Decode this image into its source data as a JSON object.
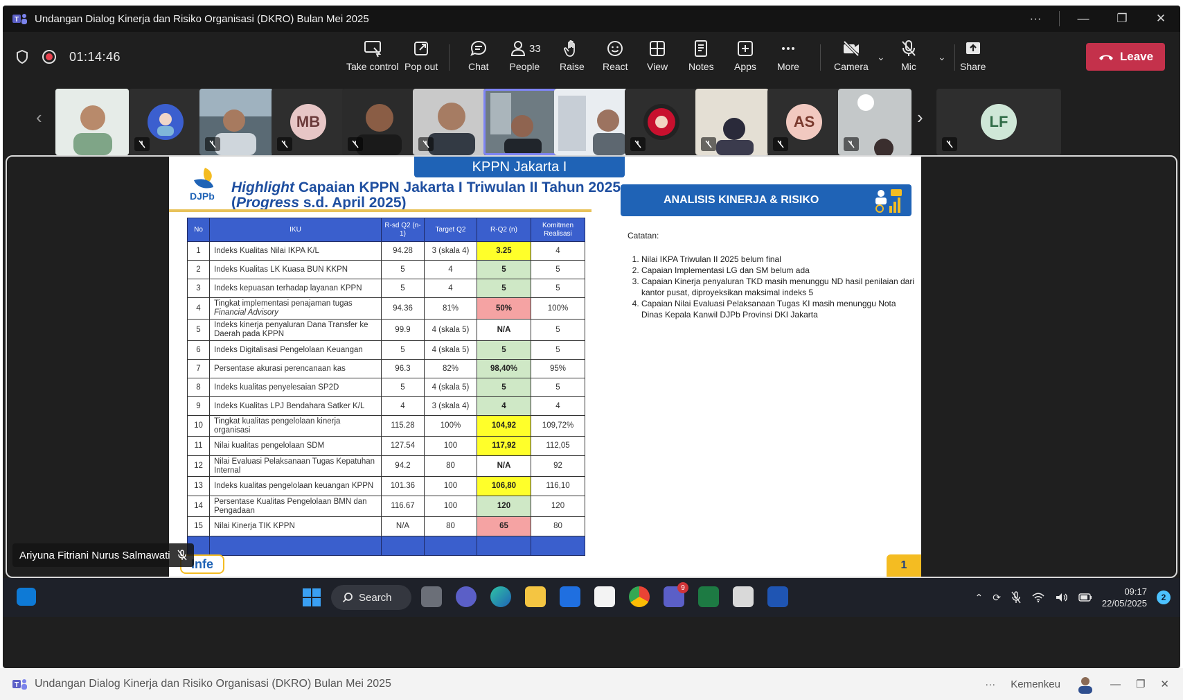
{
  "window": {
    "title": "Undangan Dialog Kinerja dan Risiko Organisasi (DKRO) Bulan Mei 2025",
    "more_label": "···",
    "minimize_label": "—",
    "restore_label": "❐",
    "close_label": "✕"
  },
  "toolbar": {
    "timer": "01:14:46",
    "take_control": "Take control",
    "pop_out": "Pop out",
    "chat": "Chat",
    "people": "People",
    "people_count": "33",
    "raise": "Raise",
    "react": "React",
    "view": "View",
    "notes": "Notes",
    "apps": "Apps",
    "more": "More",
    "camera": "Camera",
    "mic": "Mic",
    "share": "Share",
    "leave": "Leave"
  },
  "participants": [
    {
      "initials": "",
      "kind": "video",
      "muted": false
    },
    {
      "initials": "",
      "kind": "avatar-photo",
      "muted": true
    },
    {
      "initials": "",
      "kind": "video",
      "muted": true
    },
    {
      "initials": "MB",
      "kind": "initials",
      "muted": true,
      "color": "#e7c6c6"
    },
    {
      "initials": "",
      "kind": "video",
      "muted": true
    },
    {
      "initials": "",
      "kind": "video",
      "muted": true
    },
    {
      "initials": "",
      "kind": "video",
      "muted": false,
      "selected": true
    },
    {
      "initials": "",
      "kind": "video",
      "muted": false
    },
    {
      "initials": "",
      "kind": "avatar-photo",
      "muted": true
    },
    {
      "initials": "",
      "kind": "video",
      "muted": true
    },
    {
      "initials": "AS",
      "kind": "initials",
      "muted": true,
      "color": "#f1c9c0"
    },
    {
      "initials": "",
      "kind": "video",
      "muted": true
    },
    {
      "initials": "LF",
      "kind": "initials",
      "muted": true,
      "color": "#cfe7d7"
    }
  ],
  "stage": {
    "presenter_name": "Ariyuna Fitriani Nurus Salmawati"
  },
  "slide": {
    "banner": "KPPN Jakarta I",
    "logo_text": "DJPb",
    "title_line1_italic": "Highlight",
    "title_line1_rest": " Capaian KPPN Jakarta I Triwulan II Tahun 2025",
    "title_line2_open": "(",
    "title_line2_italic": "Progress",
    "title_line2_rest": " s.d. April 2025)",
    "analisis_title": "ANALISIS KINERJA & RISIKO",
    "catatan_head": "Catatan:",
    "catatan_items": [
      "Nilai IKPA Triwulan II 2025 belum final",
      "Capaian Implementasi LG dan SM belum ada",
      "Capaian Kinerja penyaluran TKD masih menunggu ND hasil penilaian dari kantor pusat, diproyeksikan maksimal indeks 5",
      "Capaian Nilai Evaluasi Pelaksanaan Tugas KI masih menunggu Nota Dinas Kepala Kanwil DJPb Provinsi DKI Jakarta"
    ],
    "page_number": "1",
    "footer_logo": "Infe",
    "table": {
      "headers": [
        "No",
        "IKU",
        "R-sd Q2 (n-1)",
        "Target Q2",
        "R-Q2 (n)",
        "Komitmen Realisasi"
      ],
      "rows": [
        {
          "no": "1",
          "iku": "Indeks Kualitas Nilai IKPA K/L",
          "prev": "94.28",
          "target": "3 (skala 4)",
          "r": "3.25",
          "status": "yellow",
          "komit": "4"
        },
        {
          "no": "2",
          "iku": "Indeks Kualitas LK Kuasa BUN KKPN",
          "prev": "5",
          "target": "4",
          "r": "5",
          "status": "green",
          "komit": "5"
        },
        {
          "no": "3",
          "iku": "Indeks kepuasan terhadap layanan KPPN",
          "prev": "5",
          "target": "4",
          "r": "5",
          "status": "green",
          "komit": "5"
        },
        {
          "no": "4",
          "iku": "Tingkat implementasi penajaman tugas",
          "iku2": "Financial Advisory",
          "prev": "94.36",
          "target": "81%",
          "r": "50%",
          "status": "red",
          "komit": "100%"
        },
        {
          "no": "5",
          "iku": "Indeks kinerja penyaluran Dana Transfer ke Daerah pada KPPN",
          "prev": "99.9",
          "target": "4 (skala 5)",
          "r": "N/A",
          "status": "plain",
          "komit": "5"
        },
        {
          "no": "6",
          "iku": "Indeks Digitalisasi Pengelolaan Keuangan",
          "prev": "5",
          "target": "4 (skala 5)",
          "r": "5",
          "status": "green",
          "komit": "5"
        },
        {
          "no": "7",
          "iku": "Persentase akurasi perencanaan kas",
          "prev": "96.3",
          "target": "82%",
          "r": "98,40%",
          "status": "green",
          "komit": "95%"
        },
        {
          "no": "8",
          "iku": "Indeks kualitas penyelesaian SP2D",
          "prev": "5",
          "target": "4 (skala 5)",
          "r": "5",
          "status": "green",
          "komit": "5"
        },
        {
          "no": "9",
          "iku": "Indeks Kualitas LPJ Bendahara Satker K/L",
          "prev": "4",
          "target": "3 (skala 4)",
          "r": "4",
          "status": "green",
          "komit": "4"
        },
        {
          "no": "10",
          "iku": "Tingkat kualitas pengelolaan kinerja organisasi",
          "prev": "115.28",
          "target": "100%",
          "r": "104,92",
          "status": "yellow",
          "komit": "109,72%"
        },
        {
          "no": "11",
          "iku": "Nilai kualitas pengelolaan SDM",
          "prev": "127.54",
          "target": "100",
          "r": "117,92",
          "status": "yellow",
          "komit": "112,05"
        },
        {
          "no": "12",
          "iku": "Nilai Evaluasi Pelaksanaan Tugas Kepatuhan Internal",
          "prev": "94.2",
          "target": "80",
          "r": "N/A",
          "status": "plain",
          "komit": "92"
        },
        {
          "no": "13",
          "iku": "Indeks kualitas pengelolaan keuangan KPPN",
          "prev": "101.36",
          "target": "100",
          "r": "106,80",
          "status": "yellow",
          "komit": "116,10"
        },
        {
          "no": "14",
          "iku": "Persentase Kualitas Pengelolaan BMN dan Pengadaan",
          "prev": "116.67",
          "target": "100",
          "r": "120",
          "status": "green",
          "komit": "120"
        },
        {
          "no": "15",
          "iku": "Nilai Kinerja TIK KPPN",
          "prev": "N/A",
          "target": "80",
          "r": "65",
          "status": "red",
          "komit": "80"
        }
      ]
    }
  },
  "taskbar": {
    "search_label": "Search",
    "teams_badge": "9",
    "time": "09:17",
    "date": "22/05/2025",
    "notification_count": "2"
  },
  "bottombar": {
    "title": "Undangan Dialog Kinerja dan Risiko Organisasi (DKRO) Bulan Mei 2025",
    "more_label": "···",
    "org": "Kemenkeu"
  },
  "colors": {
    "leave": "#c4314b",
    "slide_blue": "#1f63b6",
    "table_header": "#3a5fcd",
    "yellow_cell": "#ffff2a",
    "green_cell": "#cfe8c6",
    "red_cell": "#f5a3a3"
  }
}
